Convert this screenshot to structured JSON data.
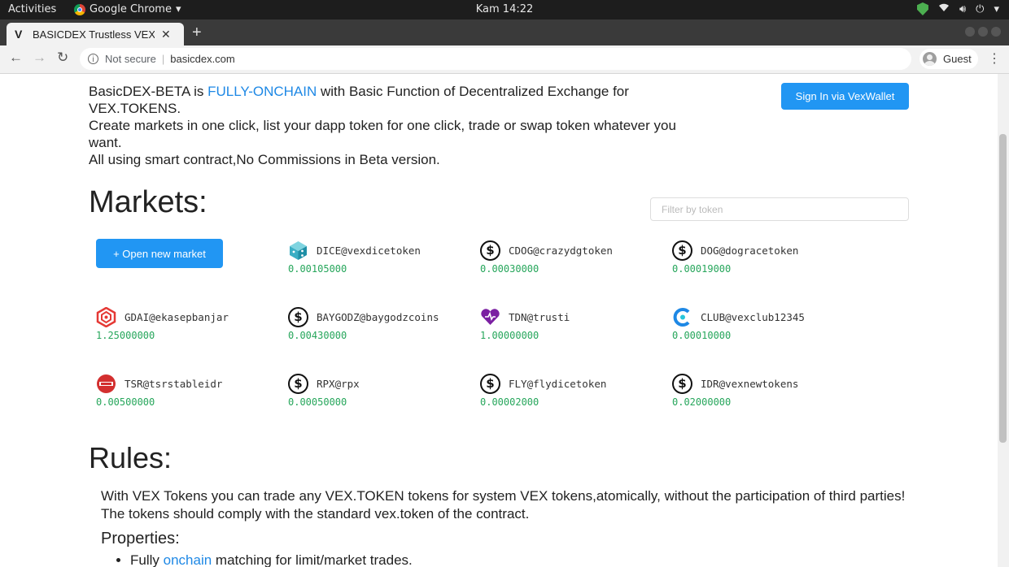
{
  "os": {
    "activities": "Activities",
    "app_name": "Google Chrome",
    "clock": "Kam 14:22"
  },
  "browser": {
    "tab_title": "BASICDEX Trustless VEX.",
    "url_security": "Not secure",
    "url": "basicdex.com",
    "profile": "Guest"
  },
  "intro": {
    "pre": "BasicDEX-BETA is ",
    "highlight": "FULLY-ONCHAIN",
    "post": " with Basic Function of Decentralized Exchange for VEX.TOKENS.",
    "line2": "Create markets in one click, list your dapp token for one click, trade or swap token whatever you want.",
    "line3": "All using smart contract,No Commissions in Beta version."
  },
  "signin_label": "Sign In via VexWallet",
  "markets": {
    "title": "Markets:",
    "filter_placeholder": "Filter by token",
    "open_label": "+ Open new market",
    "items": [
      {
        "name": "DICE@vexdicetoken",
        "price": "0.00105000",
        "icon": "dice-icon"
      },
      {
        "name": "CDOG@crazydgtoken",
        "price": "0.00030000",
        "icon": "dollar-icon"
      },
      {
        "name": "DOG@dogracetoken",
        "price": "0.00019000",
        "icon": "dollar-icon"
      },
      {
        "name": "GDAI@ekasepbanjar",
        "price": "1.25000000",
        "icon": "hexagon-logo-icon"
      },
      {
        "name": "BAYGODZ@baygodzcoins",
        "price": "0.00430000",
        "icon": "dollar-icon"
      },
      {
        "name": "TDN@trusti",
        "price": "1.00000000",
        "icon": "heart-logo-icon"
      },
      {
        "name": "CLUB@vexclub12345",
        "price": "0.00010000",
        "icon": "club-logo-icon"
      },
      {
        "name": "TSR@tsrstableidr",
        "price": "0.00500000",
        "icon": "tsr-logo-icon"
      },
      {
        "name": "RPX@rpx",
        "price": "0.00050000",
        "icon": "dollar-icon"
      },
      {
        "name": "FLY@flydicetoken",
        "price": "0.00002000",
        "icon": "dollar-icon"
      },
      {
        "name": "IDR@vexnewtokens",
        "price": "0.02000000",
        "icon": "dollar-icon"
      }
    ]
  },
  "rules": {
    "title": "Rules:",
    "text": "With VEX Tokens you can trade any VEX.TOKEN tokens for system VEX tokens,atomically, without the participation of third parties! The tokens should comply with the standard vex.token of the contract.",
    "properties_title": "Properties:",
    "item1_pre": "Fully ",
    "item1_link": "onchain",
    "item1_post": " matching for limit/market trades."
  },
  "colors": {
    "accent": "#2196f3",
    "price": "#26a65b",
    "link": "#1e88e5"
  }
}
